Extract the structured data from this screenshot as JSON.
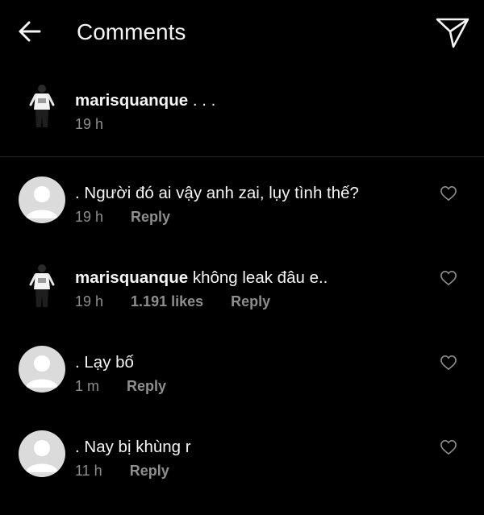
{
  "header": {
    "title": "Comments",
    "back_icon": "arrow-left-icon",
    "share_icon": "paper-plane-icon"
  },
  "caption": {
    "username": "marisquanque",
    "text": " . . .",
    "time": "19 h"
  },
  "comments": [
    {
      "username": "",
      "text": ". Người đó ai vậy anh zai, lụy tình thế?",
      "time": "19 h",
      "likes": "",
      "reply": "Reply"
    },
    {
      "username": "marisquanque",
      "text": " không leak đâu e..",
      "time": "19 h",
      "likes": "1.191 likes",
      "reply": "Reply"
    },
    {
      "username": "",
      "text": ". Lạy bố",
      "time": "1 m",
      "likes": "",
      "reply": "Reply"
    },
    {
      "username": "",
      "text": ". Nay bị khùng r",
      "time": "11 h",
      "likes": "",
      "reply": "Reply"
    }
  ],
  "colors": {
    "background": "#000000",
    "text": "#f5f5f5",
    "secondary": "#8e8e8e",
    "default_avatar": "#dbdbdb"
  }
}
